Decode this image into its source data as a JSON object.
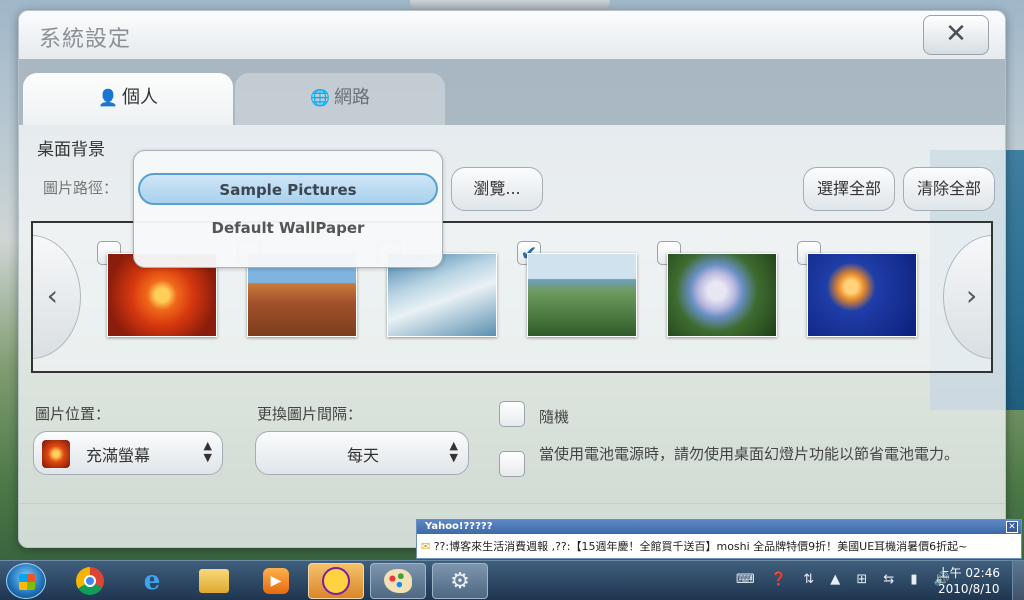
{
  "dialog": {
    "title": "系統設定",
    "close_label": "✕",
    "tabs": [
      {
        "label": "個人",
        "icon": "👤"
      },
      {
        "label": "網路",
        "icon": "🌐"
      }
    ]
  },
  "wallpaper": {
    "section_title": "桌面背景",
    "path_label": "圖片路徑：",
    "dropdown_options": [
      "Sample Pictures",
      "Default WallPaper"
    ],
    "selected_option": "Sample Pictures",
    "browse_label": "瀏覽...",
    "select_all_label": "選擇全部",
    "clear_all_label": "清除全部",
    "prev_arrow": "‹",
    "next_arrow": "›",
    "check_mark": "✔",
    "thumbnails": [
      {
        "name": "chrysanthemum",
        "checked": false
      },
      {
        "name": "desert",
        "checked": false
      },
      {
        "name": "sky",
        "checked": false
      },
      {
        "name": "coast",
        "checked": true
      },
      {
        "name": "hydrangeas",
        "checked": false
      },
      {
        "name": "jellyfish",
        "checked": false
      }
    ],
    "position_label": "圖片位置：",
    "position_value": "充滿螢幕",
    "interval_label": "更換圖片間隔：",
    "interval_value": "每天",
    "random_label": "隨機",
    "battery_label": "當使用電池電源時，請勿使用桌面幻燈片功能以節省電池電力。"
  },
  "yahoo_popup": {
    "header": "Yahoo!?????",
    "close": "✕",
    "message": "??:博客來生活消費週報 ,??:【15週年慶！全館買千送百】moshi 全品牌特價9折！美國UE耳機消暑價6折起~"
  },
  "taskbar": {
    "clock_time": "上午 02:46",
    "clock_date": "2010/8/10"
  },
  "colors": {
    "accent": "#5aa0cf",
    "taskbar": "#2a4560"
  }
}
